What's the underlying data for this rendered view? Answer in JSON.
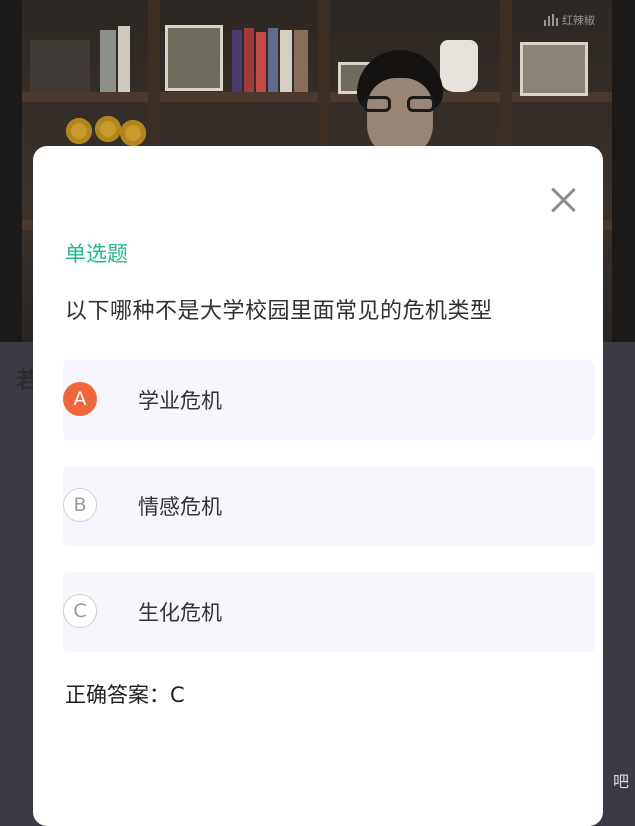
{
  "background": {
    "watermark": "红辣椒",
    "side_glyph": "若",
    "corner_text": "吧"
  },
  "modal": {
    "question_type": "单选题",
    "question": "以下哪种不是大学校园里面常见的危机类型",
    "options": [
      {
        "letter": "A",
        "text": "学业危机",
        "selected": true
      },
      {
        "letter": "B",
        "text": "情感危机",
        "selected": false
      },
      {
        "letter": "C",
        "text": "生化危机",
        "selected": false
      }
    ],
    "answer_text": "正确答案：C"
  },
  "colors": {
    "accent_green": "#25b88a",
    "selected_orange": "#f0663a"
  },
  "icons": {
    "close": "close-icon"
  }
}
